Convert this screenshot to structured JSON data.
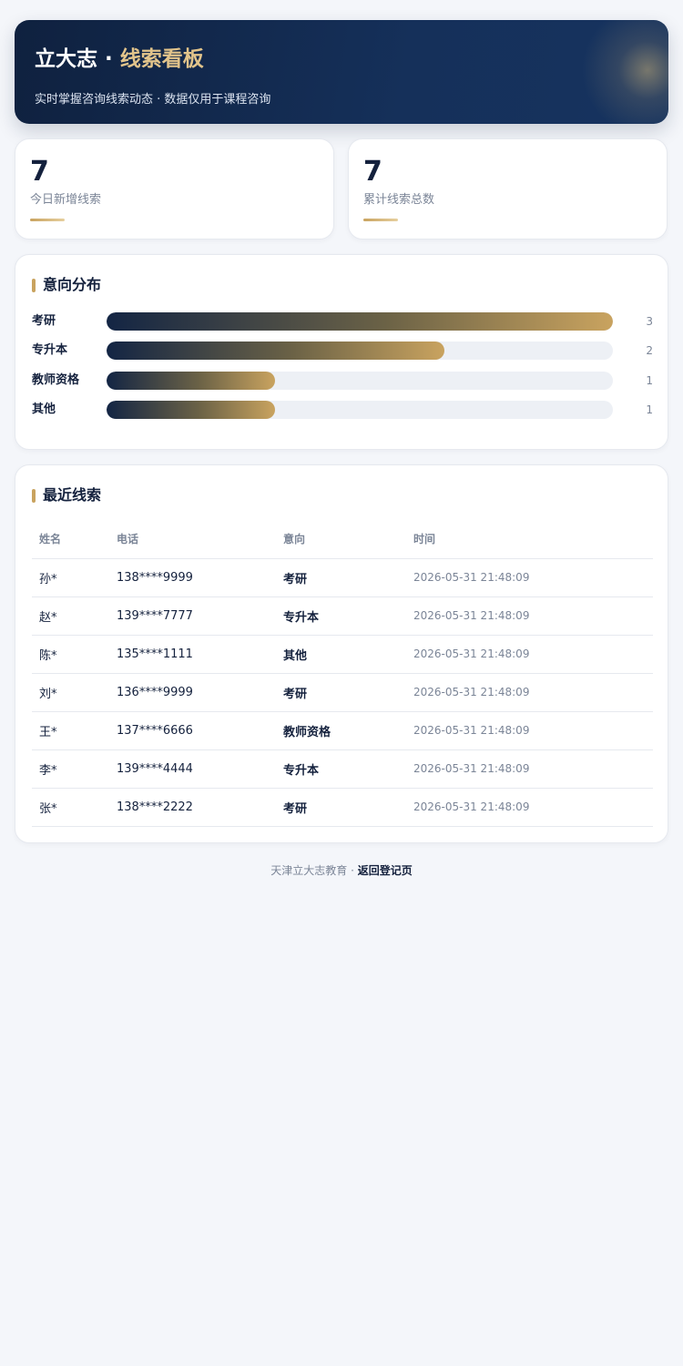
{
  "header": {
    "brand": "立大志 · ",
    "title_accent": "线索看板",
    "subtitle": "实时掌握咨询线索动态 · 数据仅用于课程咨询"
  },
  "stats": [
    {
      "value": "7",
      "label": "今日新增线索"
    },
    {
      "value": "7",
      "label": "累计线索总数"
    }
  ],
  "distribution": {
    "title": "意向分布",
    "items": [
      {
        "label": "考研",
        "count": 3
      },
      {
        "label": "专升本",
        "count": 2
      },
      {
        "label": "教师资格",
        "count": 1
      },
      {
        "label": "其他",
        "count": 1
      }
    ]
  },
  "leads": {
    "title": "最近线索",
    "columns": [
      "姓名",
      "电话",
      "意向",
      "时间"
    ],
    "rows": [
      {
        "name": "孙*",
        "phone": "138****9999",
        "intent": "考研",
        "time": "2026-05-31 21:48:09"
      },
      {
        "name": "赵*",
        "phone": "139****7777",
        "intent": "专升本",
        "time": "2026-05-31 21:48:09"
      },
      {
        "name": "陈*",
        "phone": "135****1111",
        "intent": "其他",
        "time": "2026-05-31 21:48:09"
      },
      {
        "name": "刘*",
        "phone": "136****9999",
        "intent": "考研",
        "time": "2026-05-31 21:48:09"
      },
      {
        "name": "王*",
        "phone": "137****6666",
        "intent": "教师资格",
        "time": "2026-05-31 21:48:09"
      },
      {
        "name": "李*",
        "phone": "139****4444",
        "intent": "专升本",
        "time": "2026-05-31 21:48:09"
      },
      {
        "name": "张*",
        "phone": "138****2222",
        "intent": "考研",
        "time": "2026-05-31 21:48:09"
      }
    ]
  },
  "footer": {
    "org": "天津立大志教育 · ",
    "link": "返回登记页"
  },
  "colors": {
    "navy": "#14213d",
    "gold": "#c9a35f",
    "gold_light": "#e2c48b",
    "muted": "#7b8597",
    "background": "#f4f6fa"
  }
}
